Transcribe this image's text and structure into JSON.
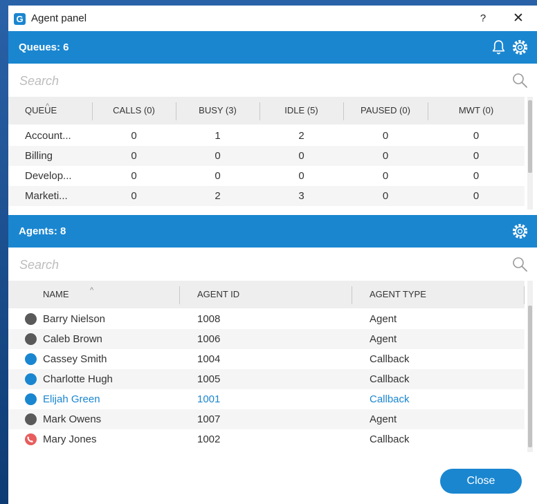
{
  "window": {
    "title": "Agent panel",
    "help_label": "?",
    "close_label": "✕"
  },
  "colors": {
    "accent": "#1a86d0",
    "status_offline": "#5a5a5a",
    "status_available": "#1a86d0",
    "status_on_call": "#e85d5d"
  },
  "queues": {
    "title": "Queues: 6",
    "search_placeholder": "Search",
    "columns": [
      "QUEUE",
      "CALLS (0)",
      "BUSY (3)",
      "IDLE (5)",
      "PAUSED (0)",
      "MWT (0)"
    ],
    "rows": [
      [
        "Account...",
        "0",
        "1",
        "2",
        "0",
        "0"
      ],
      [
        "Billing",
        "0",
        "0",
        "0",
        "0",
        "0"
      ],
      [
        "Develop...",
        "0",
        "0",
        "0",
        "0",
        "0"
      ],
      [
        "Marketi...",
        "0",
        "2",
        "3",
        "0",
        "0"
      ]
    ]
  },
  "agents": {
    "title": "Agents: 8",
    "search_placeholder": "Search",
    "columns": [
      "NAME",
      "AGENT ID",
      "AGENT TYPE"
    ],
    "rows": [
      {
        "name": "Barry Nielson",
        "id": "1008",
        "type": "Agent",
        "status": "offline"
      },
      {
        "name": "Caleb Brown",
        "id": "1006",
        "type": "Agent",
        "status": "offline"
      },
      {
        "name": "Cassey Smith",
        "id": "1004",
        "type": "Callback",
        "status": "available"
      },
      {
        "name": "Charlotte Hugh",
        "id": "1005",
        "type": "Callback",
        "status": "available"
      },
      {
        "name": "Elijah Green",
        "id": "1001",
        "type": "Callback",
        "status": "available",
        "selected": true
      },
      {
        "name": "Mark Owens",
        "id": "1007",
        "type": "Agent",
        "status": "offline"
      },
      {
        "name": "Mary Jones",
        "id": "1002",
        "type": "Callback",
        "status": "on-call"
      }
    ]
  },
  "footer": {
    "close_label": "Close"
  }
}
